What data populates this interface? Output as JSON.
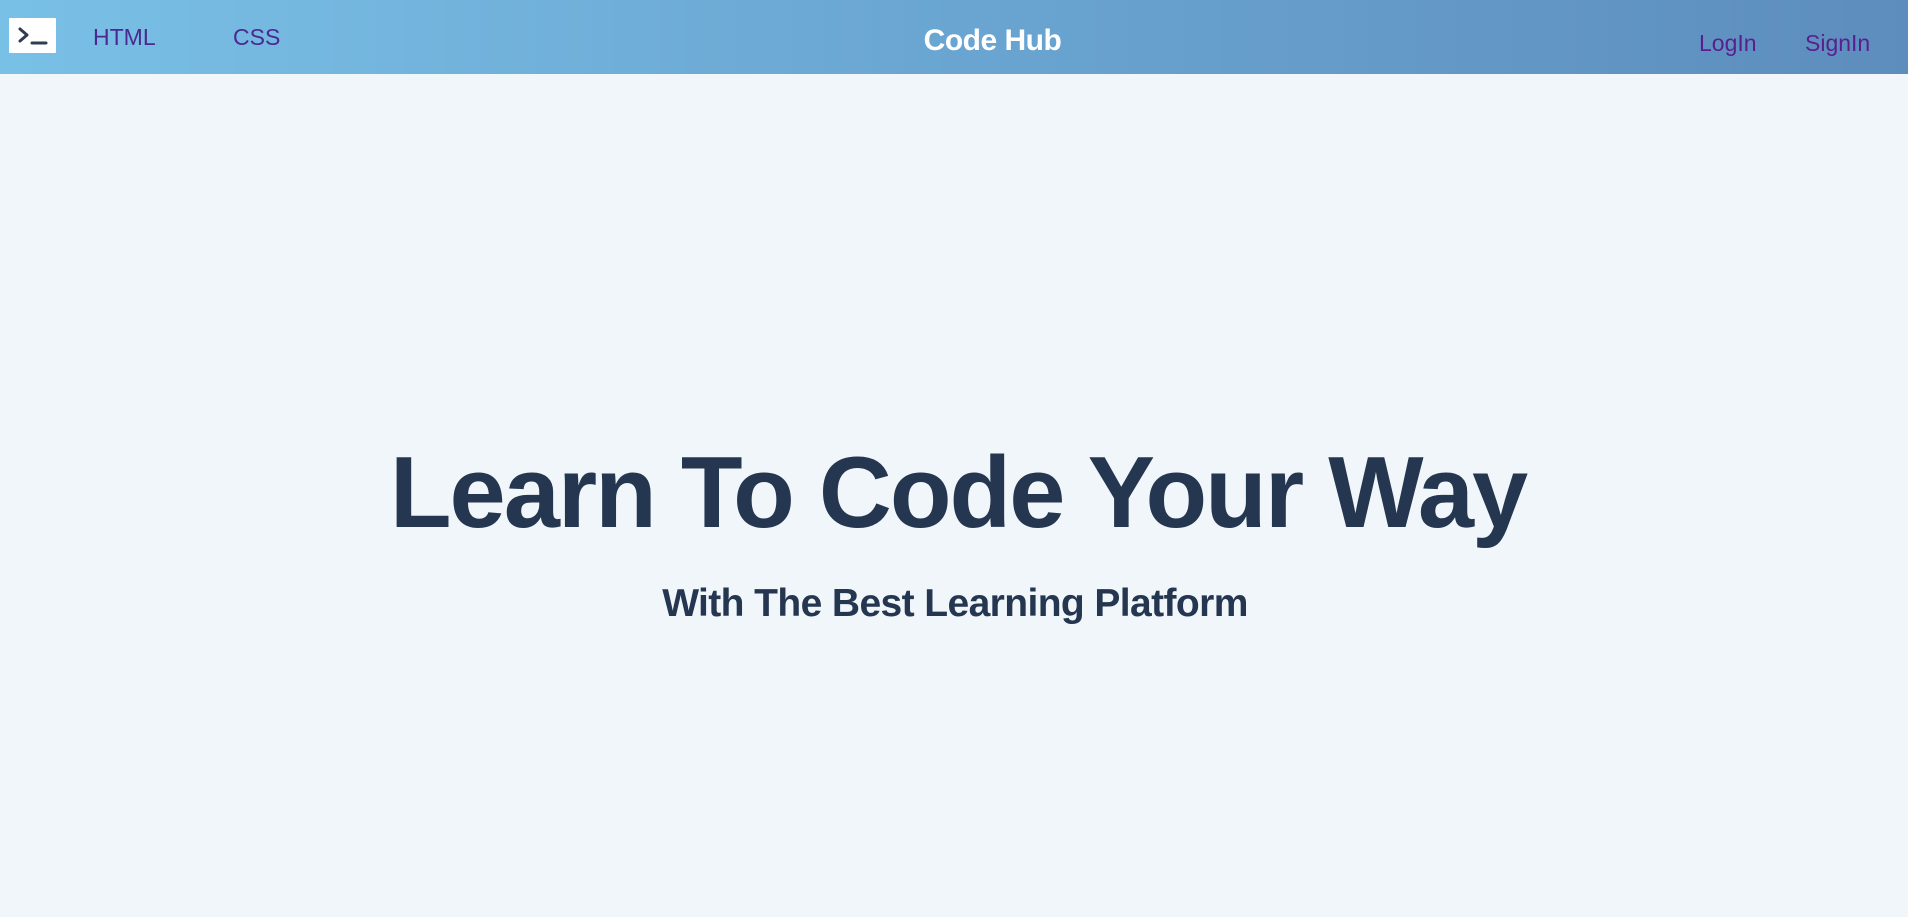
{
  "navbar": {
    "logo_icon": "terminal-prompt-icon",
    "links_left": [
      {
        "label": "HTML"
      },
      {
        "label": "CSS"
      }
    ],
    "brand": "Code Hub",
    "links_right": [
      {
        "label": "LogIn"
      },
      {
        "label": "SignIn"
      }
    ],
    "colors": {
      "gradient_start": "#79c0e6",
      "gradient_end": "#5d8dbd",
      "link": "#4a2a92"
    }
  },
  "hero": {
    "title": "Learn To Code Your Way",
    "subtitle": "With The Best Learning Platform",
    "colors": {
      "background": "#f0f6f9",
      "text": "#253650"
    }
  }
}
